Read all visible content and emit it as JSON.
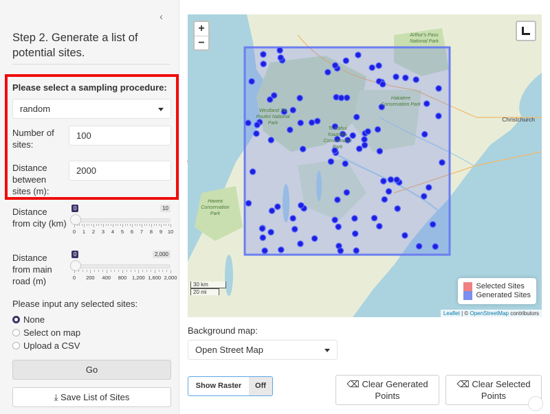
{
  "sidebar": {
    "collapse_glyph": "‹",
    "step_title": "Step 2. Generate a list of potential sites.",
    "sampling_label": "Please select a sampling procedure:",
    "sampling_value": "random",
    "num_sites_label": "Number of sites:",
    "num_sites_value": "100",
    "distance_label": "Distance between sites (m):",
    "distance_value": "2000",
    "city_slider": {
      "label": "Distance from city (km)",
      "min_label": "0",
      "max_label": "10",
      "value": 0,
      "ticks": [
        "0",
        "1",
        "2",
        "3",
        "4",
        "5",
        "6",
        "7",
        "8",
        "9",
        "10"
      ]
    },
    "road_slider": {
      "label": "Distance from main road (m)",
      "min_label": "0",
      "max_label": "2,000",
      "value": 0,
      "ticks": [
        "0",
        "200",
        "400",
        "800",
        "1,200",
        "1,600",
        "2,000"
      ]
    },
    "selected_sites_label": "Please input any selected sites:",
    "radio_options": [
      "None",
      "Select on map",
      "Upload a CSV"
    ],
    "radio_selected": "None",
    "go_label": "Go",
    "save_label": "Save List of Sites"
  },
  "map": {
    "zoom_in": "+",
    "zoom_out": "−",
    "scale_km": "30 km",
    "scale_mi": "20 mi",
    "legend": [
      {
        "label": "Selected Sites",
        "color": "#f08080"
      },
      {
        "label": "Generated Sites",
        "color": "#7a8ff0"
      }
    ],
    "attribution_leaflet": "Leaflet",
    "attribution_sep": " | © ",
    "attribution_osm": "OpenStreetMap",
    "attribution_tail": " contributors",
    "place_labels": {
      "christchurch": "Christchurch",
      "arthurs": "Arthur's Pass National Park",
      "hakatere": "Hakatere Conservation Park",
      "westland": "Westland Tai Poutini National Park",
      "te_kahui": "Te Kahui Kaupeka Conservation Park",
      "hawea": "Hawea Conservation Park"
    }
  },
  "background_map": {
    "label": "Background map:",
    "value": "Open Street Map"
  },
  "controls": {
    "show_raster_label": "Show Raster",
    "raster_state": "Off",
    "clear_generated_label": "Clear Generated Points",
    "clear_selected_label": "Clear Selected Points"
  },
  "colors": {
    "accent": "#3b3367",
    "highlight_box": "#f00c0c",
    "site_point": "#1f1fe0",
    "sampling_box": "#6b7ef0"
  }
}
